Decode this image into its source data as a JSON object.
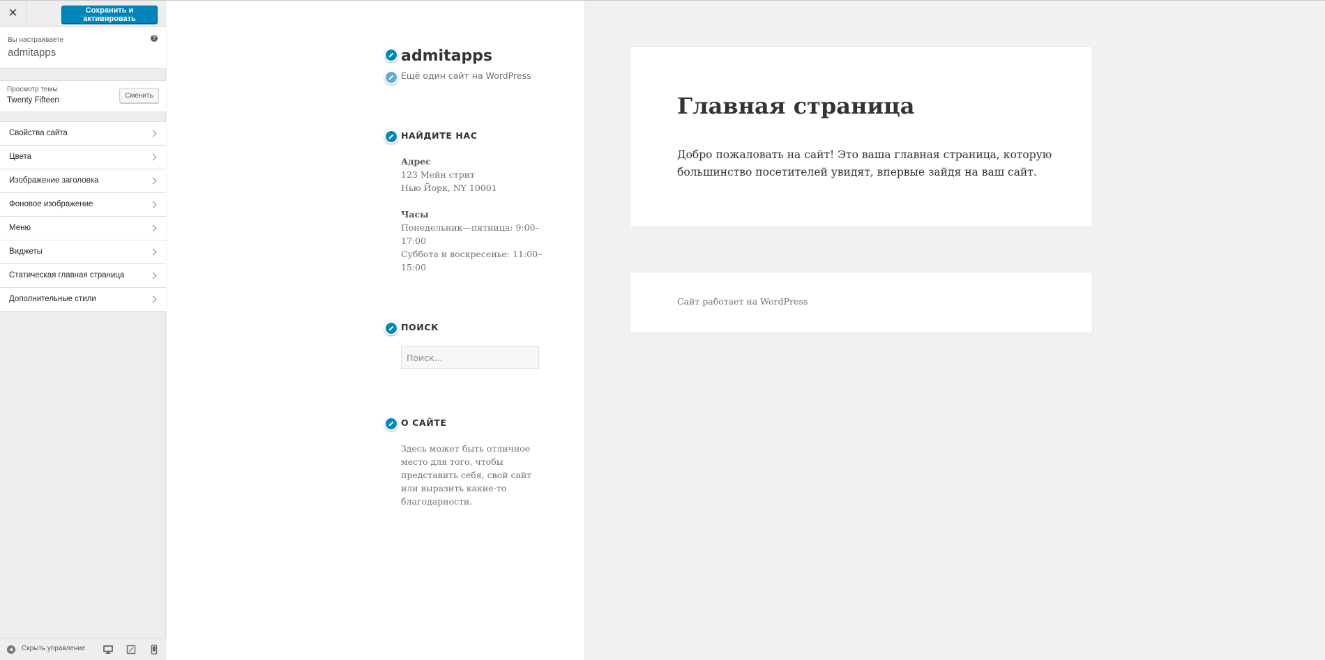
{
  "header": {
    "close_icon": "close-icon",
    "save_label": "Сохранить и активировать"
  },
  "customizing": {
    "label": "Вы настраиваете",
    "site_name": "admitapps",
    "help_icon": "help-icon",
    "help_glyph": "?"
  },
  "theme": {
    "label": "Просмотр темы",
    "name": "Twenty Fifteen",
    "change_label": "Сменить"
  },
  "sidebar": {
    "items": [
      {
        "label": "Свойства сайта"
      },
      {
        "label": "Цвета"
      },
      {
        "label": "Изображение заголовка"
      },
      {
        "label": "Фоновое изображение"
      },
      {
        "label": "Меню"
      },
      {
        "label": "Виджеты"
      },
      {
        "label": "Статическая главная страница"
      },
      {
        "label": "Дополнительные стили"
      }
    ]
  },
  "footer": {
    "collapse_label": "Скрыть управление",
    "devices": [
      "desktop-icon",
      "tablet-icon",
      "mobile-icon"
    ]
  },
  "preview": {
    "site_title": "admitapps",
    "site_description": "Ещё один сайт на WordPress",
    "widgets": {
      "find_us": {
        "title": "НАЙДИТЕ НАС",
        "address_heading": "Адрес",
        "address_line1": "123 Мейн стрит",
        "address_line2": "Нью Йорк, NY 10001",
        "hours_heading": "Часы",
        "hours_line1": "Понедельник—пятница: 9:00–17:00",
        "hours_line2": "Суббота и воскресенье: 11:00–15:00"
      },
      "search": {
        "title": "ПОИСК",
        "placeholder": "Поиск..."
      },
      "about": {
        "title": "О САЙТЕ",
        "text": "Здесь может быть отличное место для того, чтобы представить себя, свой сайт или выразить какие-то благодарности."
      }
    },
    "page": {
      "title": "Главная страница",
      "content": "Добро пожаловать на сайт! Это ваша главная страница, которую большинство посетителей увидят, впервые зайдя на ваш сайт."
    },
    "site_footer": "Сайт работает на WordPress"
  },
  "colors": {
    "accent": "#0085ba",
    "edit_shortcut": "#0087be"
  }
}
